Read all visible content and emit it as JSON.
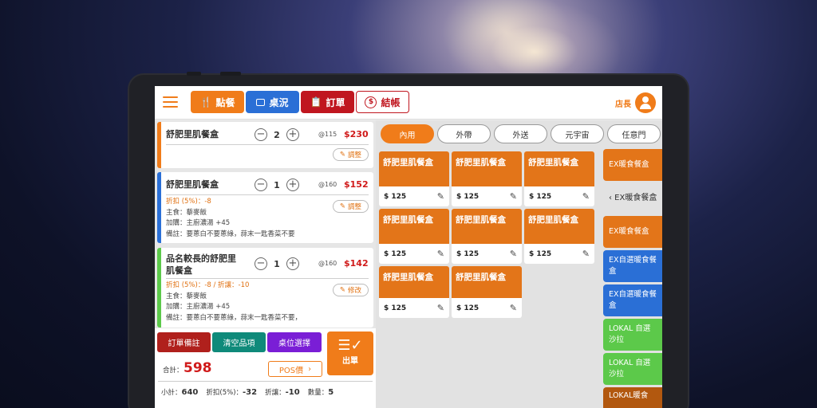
{
  "header": {
    "menu_icon": "hamburger-menu-icon",
    "tabs": [
      {
        "label": "點餐",
        "icon": "utensils-icon",
        "glyph": "🍴",
        "color": "#f07c1a"
      },
      {
        "label": "桌況",
        "icon": "monitor-icon",
        "glyph": "▭",
        "color": "#2a6fd6"
      },
      {
        "label": "訂單",
        "icon": "clipboard-search-icon",
        "glyph": "📋",
        "color": "#c0161f"
      },
      {
        "label": "結帳",
        "icon": "dollar-circle-icon",
        "glyph": "$",
        "color": "#ffffff"
      }
    ],
    "role": "店長",
    "accent": "#f07c1a"
  },
  "order_items": [
    {
      "name": "舒肥里肌餐盒",
      "qty": "2",
      "unit_price": "@115",
      "price": "$230",
      "bar_color": "#f07c1a",
      "details": [],
      "action": "調整"
    },
    {
      "name": "舒肥里肌餐盒",
      "qty": "1",
      "unit_price": "@160",
      "price": "$152",
      "bar_color": "#2a6fd6",
      "details": [
        "折扣 (5%)：-8",
        "主食：藜麥飯",
        "加購：主廚濃湯 +45",
        "備註：要蔥白不要蔥綠，蒜末一匙香菜不要"
      ],
      "action": "調整"
    },
    {
      "name": "品名較長的舒肥里肌餐盒",
      "qty": "1",
      "unit_price": "@160",
      "price": "$142",
      "bar_color": "#5cc94a",
      "details": [
        "折扣 (5%)：-8 / 折讓：-10",
        "主食：藜麥飯",
        "加購：主廚濃湯 +45",
        "備註：要蔥白不要蔥綠，蒜末一匙香菜不要，"
      ],
      "action": "修改"
    }
  ],
  "actions": {
    "order_note": "訂單備註",
    "clear_items": "清空品項",
    "select_table": "桌位選擇",
    "submit": "出單"
  },
  "totals": {
    "total_label": "合計：",
    "total_value": "598",
    "pos_price": "POS價",
    "subtotal_label": "小計：",
    "subtotal": "640",
    "discount_label": "折扣(5%)：",
    "discount": "-32",
    "allowance_label": "折讓：",
    "allowance": "-10",
    "count_label": "數量：",
    "count": "5"
  },
  "order_types": [
    "內用",
    "外帶",
    "外送",
    "元宇宙",
    "任意門"
  ],
  "active_order_type": "內用",
  "products": [
    {
      "name": "舒肥里肌餐盒",
      "price": "$ 125"
    },
    {
      "name": "舒肥里肌餐盒",
      "price": "$ 125"
    },
    {
      "name": "舒肥里肌餐盒",
      "price": "$ 125"
    },
    {
      "name": "舒肥里肌餐盒",
      "price": "$ 125"
    },
    {
      "name": "舒肥里肌餐盒",
      "price": "$ 125"
    },
    {
      "name": "舒肥里肌餐盒",
      "price": "$ 125"
    },
    {
      "name": "舒肥里肌餐盒",
      "price": "$ 125"
    },
    {
      "name": "舒肥里肌餐盒",
      "price": "$ 125"
    }
  ],
  "categories": [
    {
      "label": "EX暖食餐盒",
      "color": "#e37519"
    },
    {
      "label": "‹ EX暖食餐盒",
      "color": "transparent"
    },
    {
      "label": "EX暖食餐盒",
      "color": "#e37519"
    },
    {
      "label": "EX自選暖食餐盒",
      "color": "#2a6fd6"
    },
    {
      "label": "EX自選暖食餐盒",
      "color": "#2a6fd6"
    },
    {
      "label": "LOKAL 自選沙拉",
      "color": "#5cc94a"
    },
    {
      "label": "LOKAL 自選沙拉",
      "color": "#5cc94a"
    },
    {
      "label": "LOKAL暖食",
      "color": "#b2580f"
    }
  ]
}
